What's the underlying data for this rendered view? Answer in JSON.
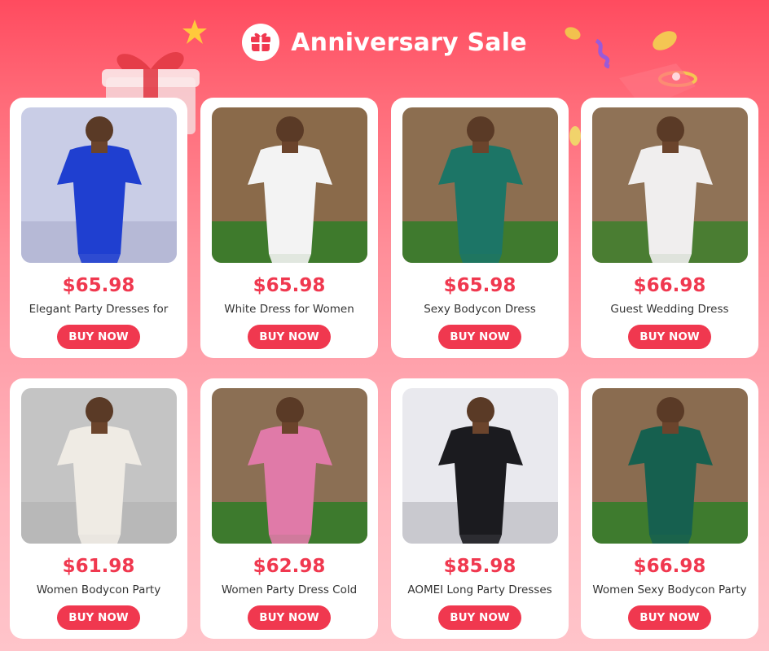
{
  "header": {
    "title": "Anniversary Sale",
    "icon": "gift-icon"
  },
  "colors": {
    "accent": "#f0384f",
    "banner_top": "#ff4b5f",
    "banner_bottom": "#ffc4ca"
  },
  "products": [
    {
      "price": "$65.98",
      "name": "Elegant Party Dresses for",
      "button": "BUY NOW",
      "dress_color": "#1f3fd0",
      "bg_color": "#c9cde6",
      "floor_color": "#b6b9d6"
    },
    {
      "price": "$65.98",
      "name": "White Dress for Women",
      "button": "BUY NOW",
      "dress_color": "#f3f3f3",
      "bg_color": "#8a6a4a",
      "floor_color": "#3e7a2c"
    },
    {
      "price": "$65.98",
      "name": "Sexy Bodycon Dress",
      "button": "BUY NOW",
      "dress_color": "#1c7566",
      "bg_color": "#8c6e50",
      "floor_color": "#3f7a2e"
    },
    {
      "price": "$66.98",
      "name": "Guest Wedding Dress",
      "button": "BUY NOW",
      "dress_color": "#f0eeee",
      "bg_color": "#8f7256",
      "floor_color": "#4a7d32"
    },
    {
      "price": "$61.98",
      "name": "Women Bodycon Party",
      "button": "BUY NOW",
      "dress_color": "#efebe4",
      "bg_color": "#c4c4c4",
      "floor_color": "#b8b8b8"
    },
    {
      "price": "$62.98",
      "name": "Women Party Dress Cold",
      "button": "BUY NOW",
      "dress_color": "#e07aa8",
      "bg_color": "#8b6f54",
      "floor_color": "#3d7a2d"
    },
    {
      "price": "$85.98",
      "name": "AOMEI Long Party Dresses",
      "button": "BUY NOW",
      "dress_color": "#1b1b1f",
      "bg_color": "#e9e9ee",
      "floor_color": "#c9c9cf"
    },
    {
      "price": "$66.98",
      "name": "Women Sexy Bodycon Party",
      "button": "BUY NOW",
      "dress_color": "#16604f",
      "bg_color": "#8a6c50",
      "floor_color": "#3e7b2e"
    }
  ]
}
